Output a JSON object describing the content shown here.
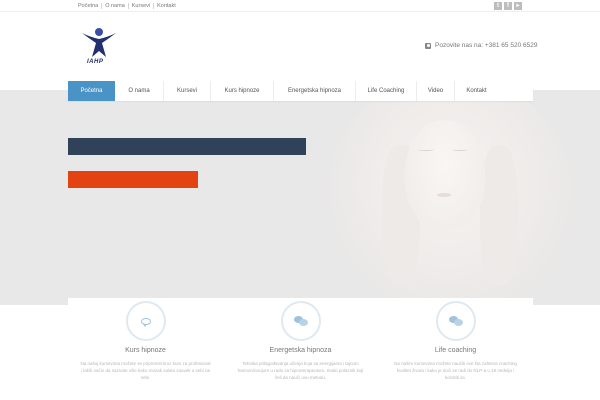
{
  "topbar": {
    "links": [
      "Početna",
      "O nama",
      "Kursevi",
      "Kontakt"
    ],
    "social": [
      "twitter-icon",
      "facebook-icon",
      "youtube-icon"
    ]
  },
  "header": {
    "logo_text": "IAHP",
    "phone_label": "Pozovite nas na: +381 65 520 6529"
  },
  "nav": {
    "items": [
      "Početna",
      "O nama",
      "Kursevi",
      "Kurs hipnoze",
      "Energetska hipnoza",
      "Life Coaching",
      "Video",
      "Kontakt"
    ],
    "active_index": 0
  },
  "colors": {
    "accent": "#4a93c7",
    "bar_blue": "#2f4259",
    "bar_orange": "#e34211"
  },
  "features": [
    {
      "icon": "comment-icon",
      "title": "Kurs hipnoze",
      "text": "Na našoj kursevima možete se pripremiti kroz kurs za profesional i lakši način da saznate više kako mozak zaista zauvek u sebi na sebi."
    },
    {
      "icon": "comments-icon",
      "title": "Energetska hipnoza",
      "text": "Tehnika prilagođavanja učenja koja sa energijama i tajnom harmonizacijom u radu sa hipnoterapeutom. Svaki polaznik koji želi da naučí ovu metodu."
    },
    {
      "icon": "comments-icon",
      "title": "Life coaching",
      "text": "Na našim kursevima možete naučiti sve šta zahteva coaching kvalitet života i kako je doći se radi do NLP-a u 18 nedelja i koristiti se."
    }
  ]
}
